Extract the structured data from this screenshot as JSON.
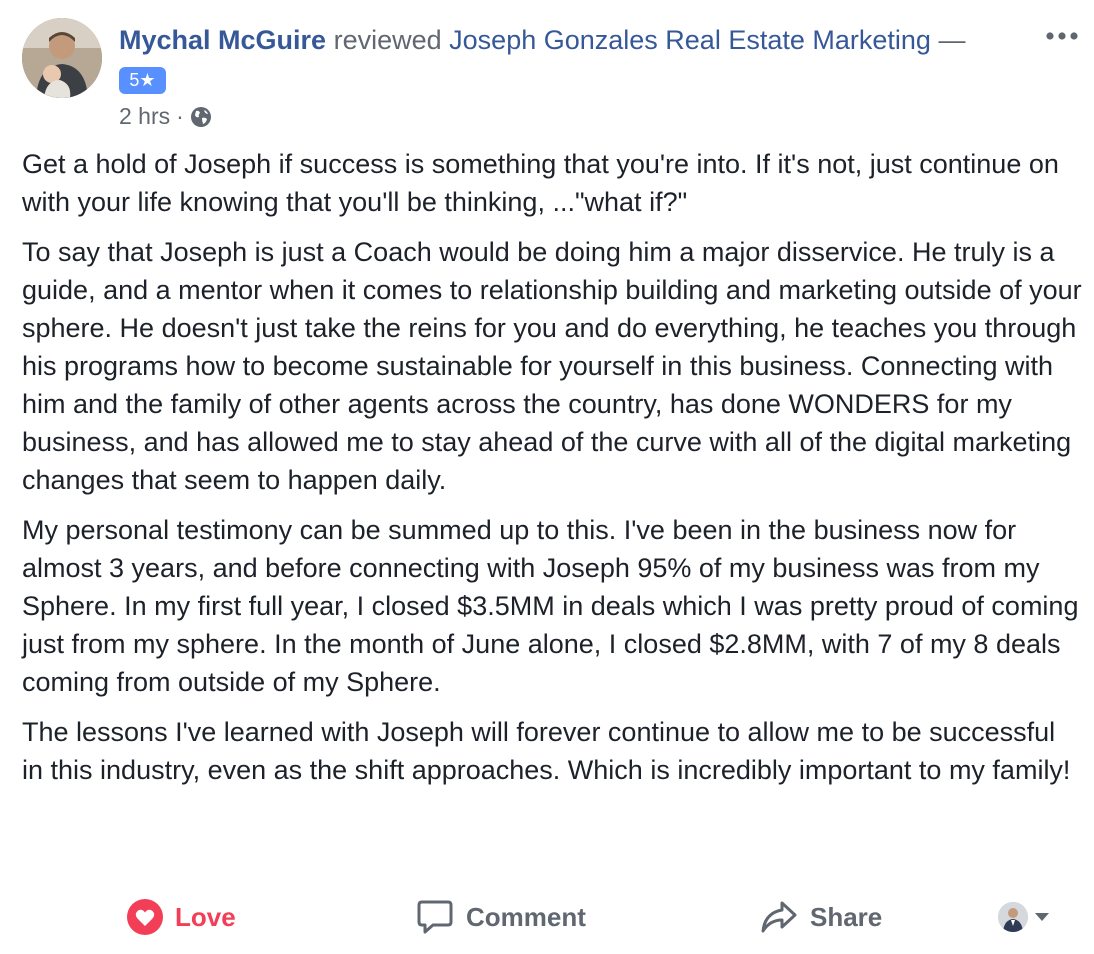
{
  "review": {
    "author": "Mychal McGuire",
    "verb": "reviewed",
    "page_name": "Joseph Gonzales Real Estate Marketing",
    "dash": "—",
    "rating": "5★",
    "time": "2 hrs",
    "separator": "·",
    "privacy_icon": "globe-icon",
    "more_icon": "more-dots-icon"
  },
  "paragraphs": [
    "Get a hold of Joseph if success is something that you're into. If it's not, just continue on with your life knowing that you'll be thinking, ...\"what if?\"",
    "To say that Joseph is just a Coach would be doing him a major disservice. He truly is a guide, and a mentor when it comes to relationship building and marketing outside of your sphere. He doesn't just take the reins for you and do everything, he teaches you through his programs how to become sustainable for yourself in this business. Connecting with him and the family of other agents across the country, has done WONDERS for my business, and has allowed me to stay ahead of the curve with all of the digital marketing changes that seem to happen daily.",
    "My personal testimony can be summed up to this. I've been in the business now for almost 3 years, and before connecting with Joseph 95% of my business was from my Sphere. In my first full year, I closed $3.5MM in deals which I was pretty proud of coming just from my sphere. In the month of June alone, I closed $2.8MM, with 7 of my 8 deals coming from outside of my Sphere.",
    "The lessons I've learned with Joseph will forever continue to allow me to be successful in this industry, even as the shift approaches. Which is incredibly important to my family!"
  ],
  "actions": {
    "love_label": "Love",
    "comment_label": "Comment",
    "share_label": "Share",
    "love_icon": "heart-icon",
    "comment_icon": "speech-bubble-icon",
    "share_icon": "share-arrow-icon",
    "audience_icon": "chevron-down-icon"
  },
  "colors": {
    "link": "#365899",
    "love": "#f33e58",
    "badge": "#5890ff",
    "muted": "#616770",
    "text": "#1d2129"
  }
}
